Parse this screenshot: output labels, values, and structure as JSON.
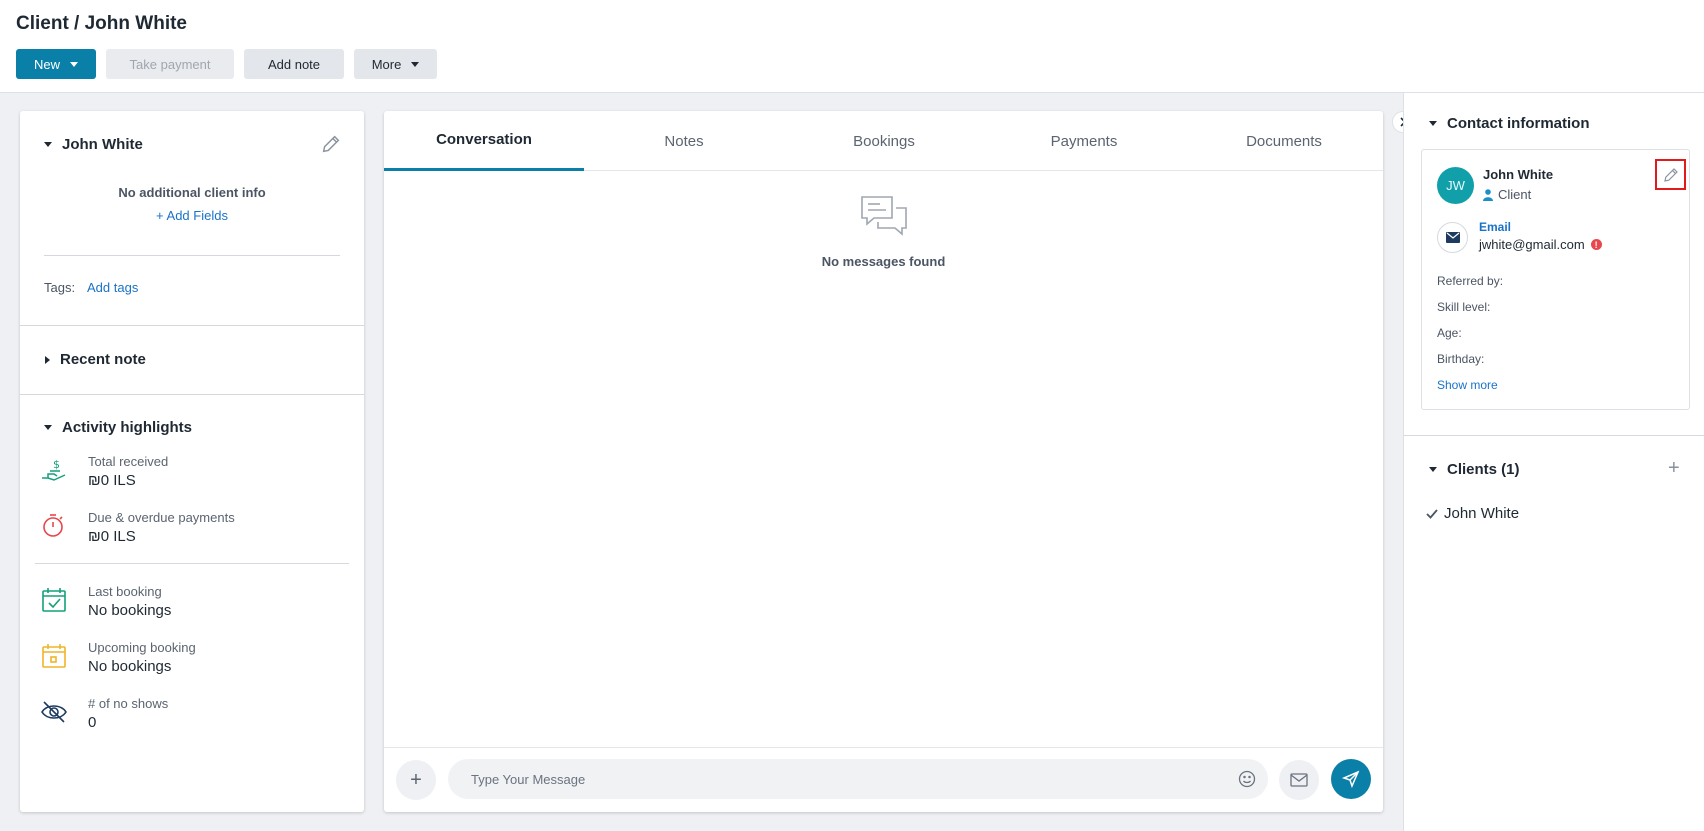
{
  "header": {
    "title": "Client / John White",
    "buttons": {
      "new": "New",
      "take_payment": "Take payment",
      "add_note": "Add note",
      "more": "More"
    }
  },
  "client_card": {
    "name": "John White",
    "no_info": "No additional client info",
    "add_fields": "Add Fields",
    "tags_label": "Tags:",
    "add_tags": "Add tags",
    "recent_note": "Recent note",
    "activity_title": "Activity highlights",
    "activity": {
      "total_received": {
        "label": "Total received",
        "value": "₪0 ILS"
      },
      "due_overdue": {
        "label": "Due & overdue payments",
        "value": "₪0 ILS"
      },
      "last_booking": {
        "label": "Last booking",
        "value": "No bookings"
      },
      "upcoming_booking": {
        "label": "Upcoming booking",
        "value": "No bookings"
      },
      "no_shows": {
        "label": "# of no shows",
        "value": "0"
      }
    }
  },
  "main": {
    "tabs": [
      "Conversation",
      "Notes",
      "Bookings",
      "Payments",
      "Documents"
    ],
    "active_tab": "Conversation",
    "empty_text": "No messages found",
    "composer": {
      "placeholder": "Type Your Message"
    }
  },
  "contact": {
    "title": "Contact information",
    "initials": "JW",
    "name": "John White",
    "role": "Client",
    "email_label": "Email",
    "email": "jwhite@gmail.com",
    "fields": [
      "Referred by:",
      "Skill level:",
      "Age:",
      "Birthday:"
    ],
    "show_more": "Show more"
  },
  "clients": {
    "title": "Clients (1)",
    "items": [
      "John White"
    ]
  },
  "colors": {
    "accent": "#0a7fa8",
    "link": "#1a73c8",
    "avatar": "#11a0a9",
    "highlight": "#e01b1b"
  }
}
